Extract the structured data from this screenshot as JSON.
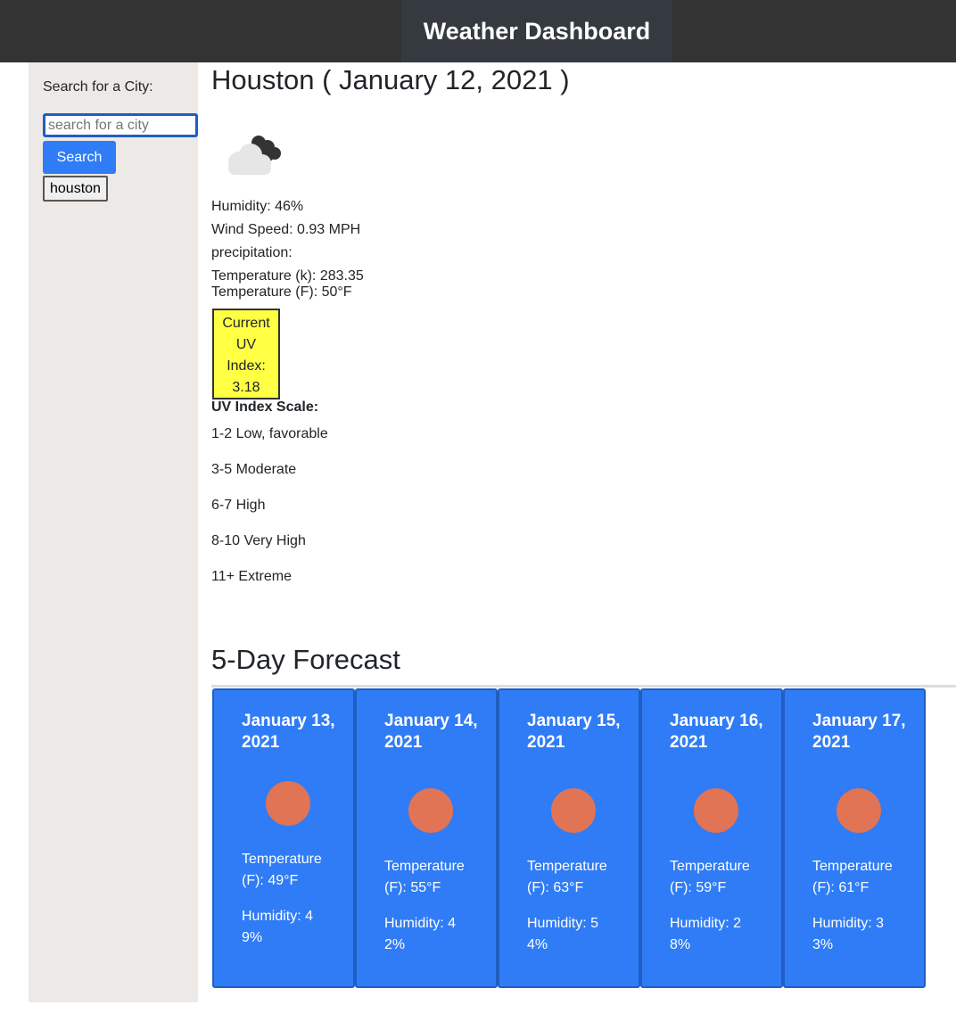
{
  "header": {
    "title": "Weather Dashboard"
  },
  "sidebar": {
    "search_label": "Search for a City:",
    "search_input": {
      "value": "",
      "placeholder": "search for a city"
    },
    "search_button": "Search",
    "history": [
      "houston"
    ]
  },
  "current": {
    "heading": "Houston ( January 12, 2021 )",
    "icon": "cloud-icon",
    "humidity": "Humidity: 46%",
    "wind_speed": "Wind Speed: 0.93 MPH",
    "precipitation": "precipitation:",
    "temp_k": "Temperature (k): 283.35",
    "temp_f": "Temperature (F): 50°F",
    "uv_badge": [
      "Current",
      "UV",
      "Index:",
      "3.18"
    ],
    "uv_badge_color": "#ffff44"
  },
  "uv_scale": {
    "title": "UV Index Scale:",
    "items": [
      "1-2 Low, favorable",
      "3-5 Moderate",
      "6-7 High",
      "8-10 Very High",
      "11+ Extreme"
    ]
  },
  "forecast": {
    "heading": "5-Day Forecast",
    "card_color": "#2f7cf6",
    "icon_color": "#e07455",
    "days": [
      {
        "date": "January 13, 2021",
        "icon": "sun-icon",
        "temp": "Temperature (F): 49°F",
        "humidity": "Humidity: 49%"
      },
      {
        "date": "January 14, 2021",
        "icon": "sun-icon",
        "temp": "Temperature (F): 55°F",
        "humidity": "Humidity: 42%"
      },
      {
        "date": "January 15, 2021",
        "icon": "sun-icon",
        "temp": "Temperature (F): 63°F",
        "humidity": "Humidity: 54%"
      },
      {
        "date": "January 16, 2021",
        "icon": "sun-icon",
        "temp": "Temperature (F): 59°F",
        "humidity": "Humidity: 28%"
      },
      {
        "date": "January 17, 2021",
        "icon": "sun-icon",
        "temp": "Temperature (F): 61°F",
        "humidity": "Humidity: 33%"
      }
    ]
  }
}
